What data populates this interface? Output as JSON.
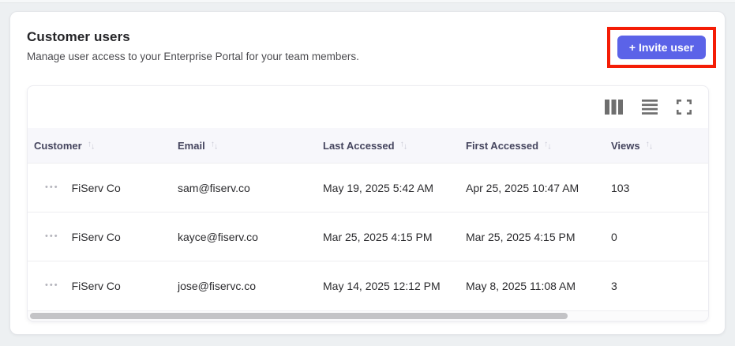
{
  "panel": {
    "title": "Customer users",
    "subtitle": "Manage user access to your Enterprise Portal for your team members.",
    "invite_button_label": "+ Invite user",
    "accent_color": "#5b63e8",
    "highlight_color": "#f41d06"
  },
  "icons": {
    "sort_up": "↑",
    "sort_down": "↓",
    "row_menu": "•••",
    "toolbar": [
      "columns-icon",
      "row-density-icon",
      "fullscreen-icon"
    ]
  },
  "table": {
    "columns": [
      {
        "label": "Customer"
      },
      {
        "label": "Email"
      },
      {
        "label": "Last Accessed"
      },
      {
        "label": "First Accessed"
      },
      {
        "label": "Views"
      }
    ],
    "rows": [
      {
        "customer": "FiServ Co",
        "email": "sam@fiserv.co",
        "last_accessed": "May 19, 2025 5:42 AM",
        "first_accessed": "Apr 25, 2025 10:47 AM",
        "views": "103"
      },
      {
        "customer": "FiServ Co",
        "email": "kayce@fiserv.co",
        "last_accessed": "Mar 25, 2025 4:15 PM",
        "first_accessed": "Mar 25, 2025 4:15 PM",
        "views": "0"
      },
      {
        "customer": "FiServ Co",
        "email": "jose@fiservc.co",
        "last_accessed": "May 14, 2025 12:12 PM",
        "first_accessed": "May 8, 2025 11:08 AM",
        "views": "3"
      }
    ],
    "scrollbar_thumb_percent": 79
  }
}
